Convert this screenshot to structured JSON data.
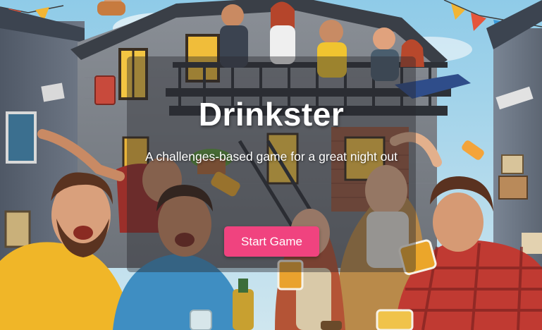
{
  "hero": {
    "title": "Drinkster",
    "subtitle": "A challenges-based game for a great night out",
    "start_button_label": "Start Game",
    "illustration_icon": "party-illustration",
    "accent_color": "#f0437f"
  }
}
